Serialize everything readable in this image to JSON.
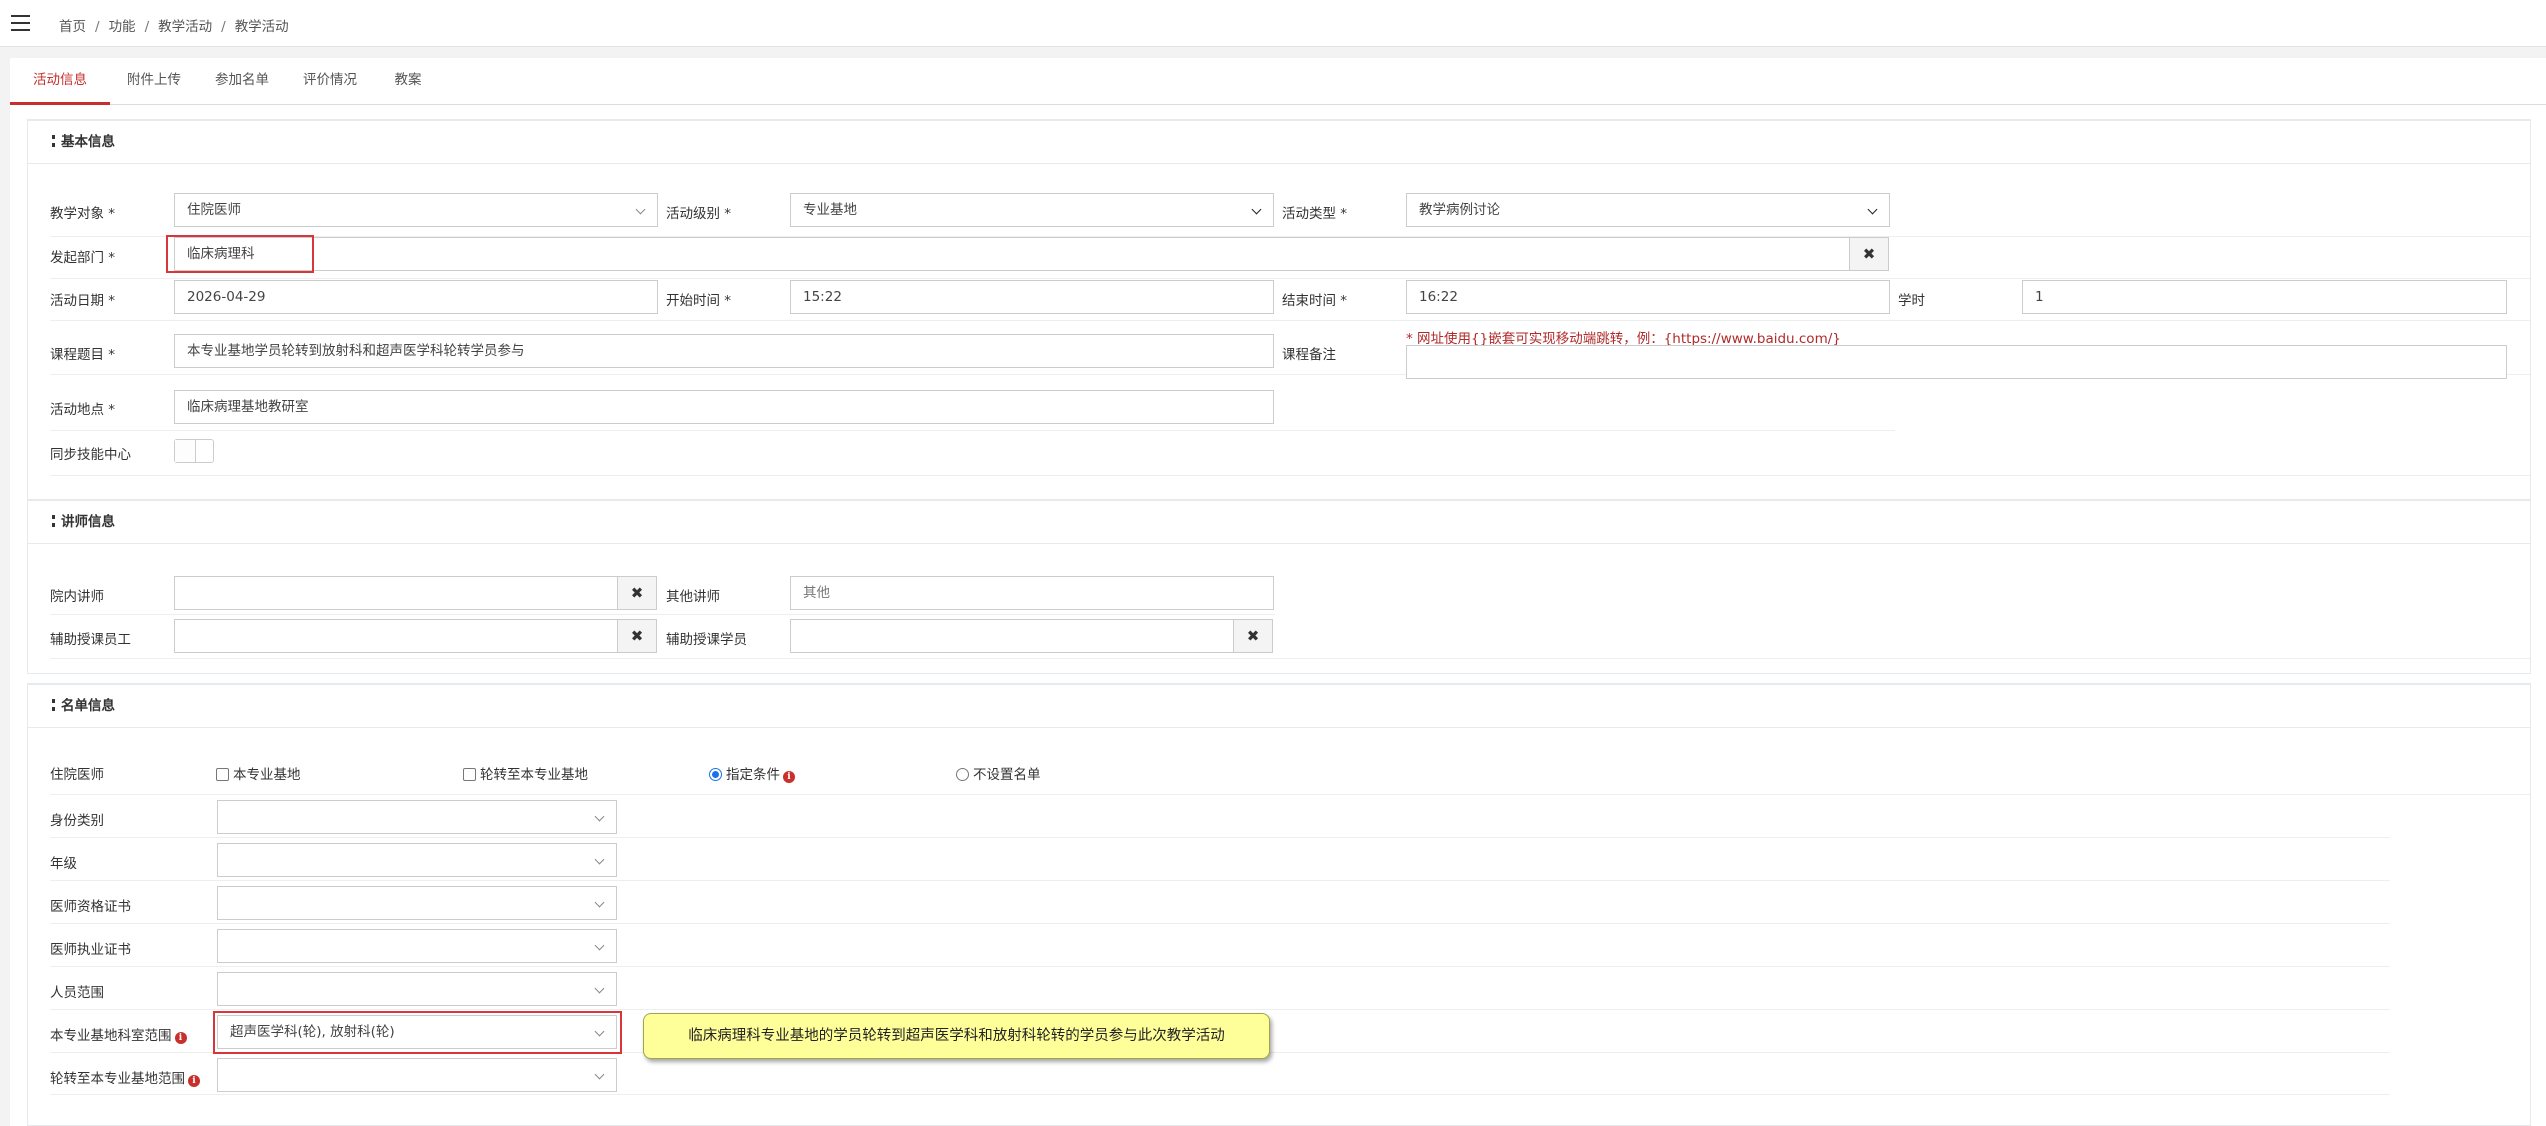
{
  "breadcrumb": {
    "home": "首页",
    "func": "功能",
    "activity": "教学活动",
    "current": "教学活动"
  },
  "tabs": [
    "活动信息",
    "附件上传",
    "参加名单",
    "评价情况",
    "教案"
  ],
  "basic": {
    "title": "基本信息",
    "teach_target_label": "教学对象 *",
    "teach_target_value": "住院医师",
    "level_label": "活动级别 *",
    "level_value": "专业基地",
    "type_label": "活动类型 *",
    "type_value": "教学病例讨论",
    "dept_label": "发起部门 *",
    "dept_value": "临床病理科",
    "date_label": "活动日期 *",
    "date_value": "2026-04-29",
    "start_label": "开始时间 *",
    "start_value": "15:22",
    "end_label": "结束时间 *",
    "end_value": "16:22",
    "hours_label": "学时",
    "hours_value": "1",
    "topic_label": "课程题目 *",
    "topic_value": "本专业基地学员轮转到放射科和超声医学科轮转学员参与",
    "note_label": "课程备注",
    "note_hint": "* 网址使用{}嵌套可实现移动端跳转，例：{https://www.baidu.com/}",
    "note_value": "",
    "place_label": "活动地点 *",
    "place_value": "临床病理基地教研室",
    "sync_label": "同步技能中心"
  },
  "lecturer": {
    "title": "讲师信息",
    "inner_label": "院内讲师",
    "inner_value": "",
    "other_label": "其他讲师",
    "other_placeholder": "其他",
    "assist_staff_label": "辅助授课员工",
    "assist_student_label": "辅助授课学员"
  },
  "roster": {
    "title": "名单信息",
    "resident_label": "住院医师",
    "opt_base": "本专业基地",
    "opt_rotate": "轮转至本专业基地",
    "opt_condition": "指定条件",
    "opt_none": "不设置名单",
    "identity_label": "身份类别",
    "grade_label": "年级",
    "qual_label": "医师资格证书",
    "practice_label": "医师执业证书",
    "scope_label": "人员范围",
    "dept_scope_label": "本专业基地科室范围",
    "dept_scope_value": "超声医学科(轮), 放射科(轮)",
    "rotate_scope_label": "轮转至本专业基地范围",
    "callout": "临床病理科专业基地的学员轮转到超声医学科和放射科轮转的学员参与此次教学活动"
  }
}
